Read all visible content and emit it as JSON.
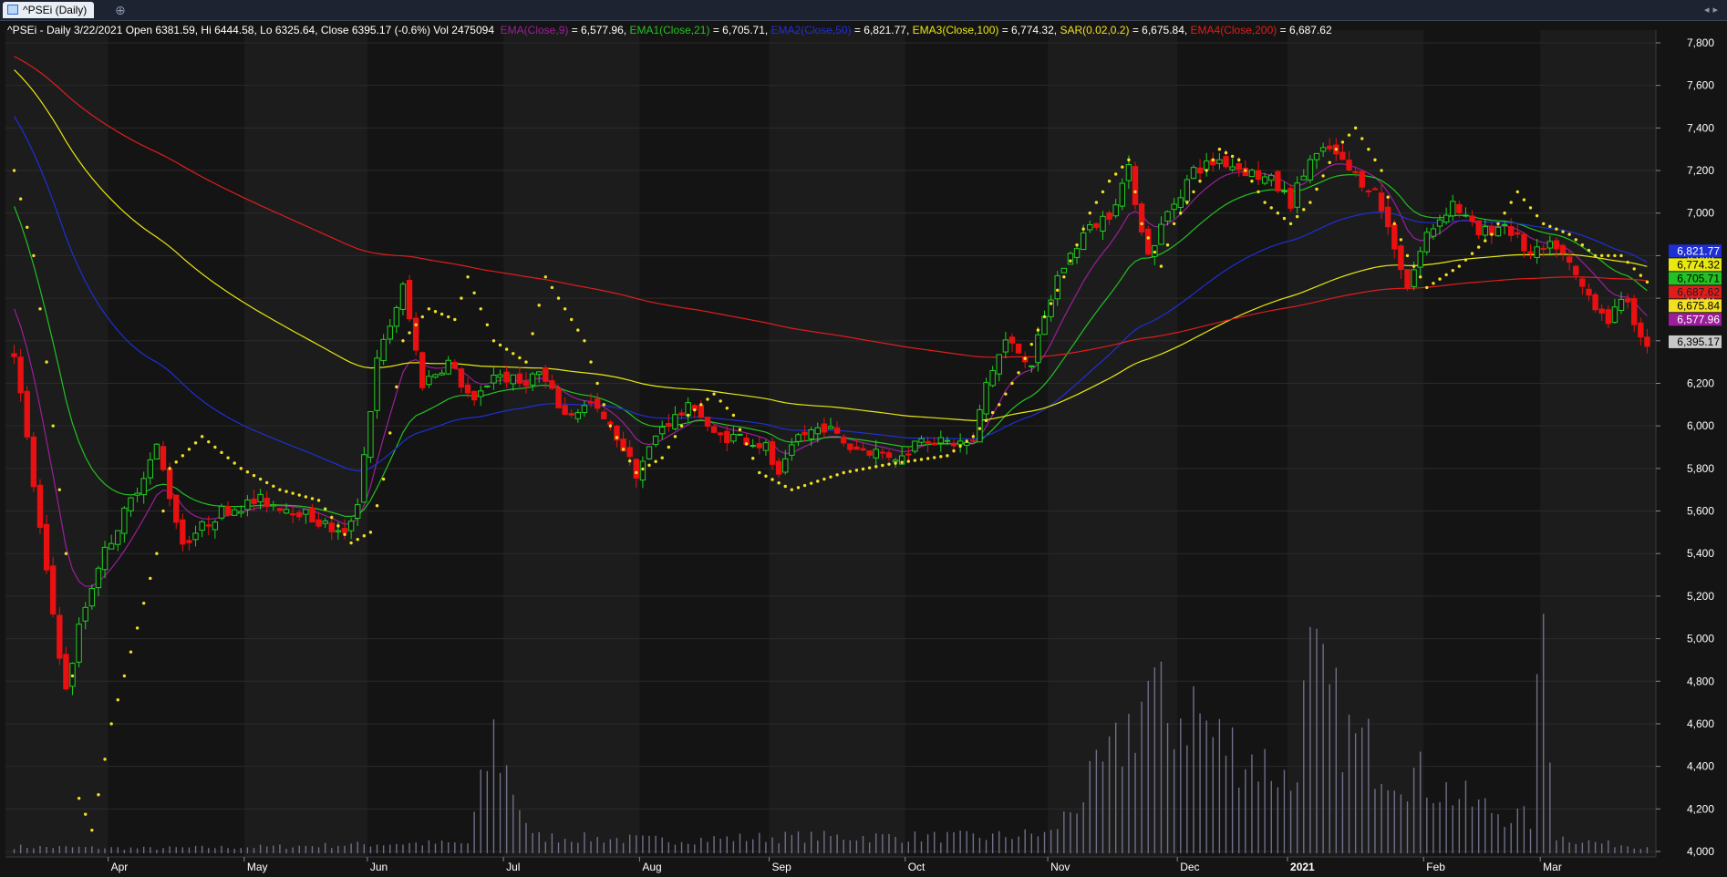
{
  "tab": {
    "title": "^PSEi (Daily)",
    "icon": "chart-icon"
  },
  "header": {
    "main": "^PSEi - Daily 3/22/2021 Open 6381.59, Hi 6444.58, Lo 6325.64, Close 6395.17 (-0.6%) Vol 2475094",
    "indicators": [
      {
        "name": "EMA(Close,9)",
        "value": "6,577.96",
        "color": "#9b1f9b"
      },
      {
        "name": "EMA1(Close,21)",
        "value": "6,705.71",
        "color": "#23c123"
      },
      {
        "name": "EMA2(Close,50)",
        "value": "6,821.77",
        "color": "#1f2fd6"
      },
      {
        "name": "EMA3(Close,100)",
        "value": "6,774.32",
        "color": "#e8e812"
      },
      {
        "name": "SAR(0.02,0.2)",
        "value": "6,675.84",
        "color": "#f2e022"
      },
      {
        "name": "EMA4(Close,200)",
        "value": "6,687.62",
        "color": "#e01d1d"
      }
    ]
  },
  "chart_data": {
    "type": "candlestick",
    "symbol": "^PSEi",
    "interval": "Daily",
    "ylim": [
      4000,
      7800
    ],
    "y_ticks": [
      4000,
      4200,
      4400,
      4600,
      4800,
      5000,
      5200,
      5400,
      5600,
      5800,
      6000,
      6200,
      6400,
      6600,
      6800,
      7000,
      7200,
      7400,
      7600,
      7800
    ],
    "y_tick_labels": [
      "4,000",
      "4,200",
      "4,400",
      "4,600",
      "4,800",
      "5,000",
      "5,200",
      "5,400",
      "5,600",
      "5,800",
      "6,000",
      "6,200",
      "6,400",
      "6,600",
      "6,800",
      "7,000",
      "7,200",
      "7,400",
      "7,600",
      "7,800"
    ],
    "x_labels": [
      {
        "label": "Apr",
        "bar": 15
      },
      {
        "label": "May",
        "bar": 36
      },
      {
        "label": "Jun",
        "bar": 55
      },
      {
        "label": "Jul",
        "bar": 76
      },
      {
        "label": "Aug",
        "bar": 97
      },
      {
        "label": "Sep",
        "bar": 117
      },
      {
        "label": "Oct",
        "bar": 138
      },
      {
        "label": "Nov",
        "bar": 160
      },
      {
        "label": "Dec",
        "bar": 180
      },
      {
        "label": "2021",
        "bar": 197
      },
      {
        "label": "Feb",
        "bar": 218
      },
      {
        "label": "Mar",
        "bar": 236
      }
    ],
    "close_keypoints": [
      [
        0,
        6350
      ],
      [
        5,
        5300
      ],
      [
        8,
        4750
      ],
      [
        10,
        5050
      ],
      [
        13,
        5350
      ],
      [
        18,
        5650
      ],
      [
        22,
        5900
      ],
      [
        26,
        5450
      ],
      [
        32,
        5600
      ],
      [
        38,
        5650
      ],
      [
        44,
        5600
      ],
      [
        51,
        5480
      ],
      [
        53,
        5650
      ],
      [
        56,
        6300
      ],
      [
        60,
        6650
      ],
      [
        63,
        6200
      ],
      [
        67,
        6300
      ],
      [
        71,
        6100
      ],
      [
        74,
        6250
      ],
      [
        78,
        6200
      ],
      [
        81,
        6250
      ],
      [
        85,
        6050
      ],
      [
        89,
        6100
      ],
      [
        93,
        5950
      ],
      [
        96,
        5780
      ],
      [
        100,
        6000
      ],
      [
        105,
        6100
      ],
      [
        108,
        5950
      ],
      [
        112,
        5950
      ],
      [
        116,
        5900
      ],
      [
        118,
        5750
      ],
      [
        121,
        5950
      ],
      [
        125,
        6000
      ],
      [
        129,
        5900
      ],
      [
        133,
        5880
      ],
      [
        137,
        5850
      ],
      [
        140,
        5960
      ],
      [
        143,
        5920
      ],
      [
        148,
        5920
      ],
      [
        150,
        6200
      ],
      [
        153,
        6400
      ],
      [
        157,
        6300
      ],
      [
        161,
        6700
      ],
      [
        165,
        6900
      ],
      [
        169,
        7000
      ],
      [
        172,
        7200
      ],
      [
        175,
        6800
      ],
      [
        178,
        7000
      ],
      [
        182,
        7200
      ],
      [
        186,
        7250
      ],
      [
        190,
        7200
      ],
      [
        194,
        7150
      ],
      [
        197,
        7050
      ],
      [
        200,
        7250
      ],
      [
        203,
        7300
      ],
      [
        206,
        7200
      ],
      [
        210,
        7100
      ],
      [
        213,
        6850
      ],
      [
        215,
        6650
      ],
      [
        218,
        6900
      ],
      [
        222,
        7050
      ],
      [
        226,
        6900
      ],
      [
        230,
        6950
      ],
      [
        234,
        6800
      ],
      [
        238,
        6850
      ],
      [
        242,
        6650
      ],
      [
        246,
        6500
      ],
      [
        249,
        6600
      ],
      [
        251,
        6400
      ],
      [
        252,
        6395.17
      ]
    ],
    "sar_keypoints": [
      [
        0,
        7200
      ],
      [
        3,
        6800
      ],
      [
        5,
        6300
      ],
      [
        8,
        5400
      ],
      [
        10,
        4250
      ],
      [
        12,
        4100
      ],
      [
        15,
        4600
      ],
      [
        19,
        5050
      ],
      [
        22,
        5400
      ],
      [
        24,
        5800
      ],
      [
        29,
        5950
      ],
      [
        35,
        5800
      ],
      [
        41,
        5700
      ],
      [
        47,
        5650
      ],
      [
        52,
        5450
      ],
      [
        55,
        5500
      ],
      [
        57,
        5750
      ],
      [
        60,
        6400
      ],
      [
        64,
        6550
      ],
      [
        68,
        6500
      ],
      [
        70,
        6700
      ],
      [
        74,
        6400
      ],
      [
        79,
        6300
      ],
      [
        82,
        6700
      ],
      [
        88,
        6400
      ],
      [
        92,
        6000
      ],
      [
        96,
        5780
      ],
      [
        100,
        5850
      ],
      [
        104,
        6050
      ],
      [
        108,
        6150
      ],
      [
        111,
        6050
      ],
      [
        115,
        5780
      ],
      [
        120,
        5700
      ],
      [
        128,
        5780
      ],
      [
        135,
        5820
      ],
      [
        144,
        5860
      ],
      [
        148,
        5950
      ],
      [
        152,
        6100
      ],
      [
        155,
        6250
      ],
      [
        158,
        6450
      ],
      [
        162,
        6700
      ],
      [
        166,
        7000
      ],
      [
        169,
        7150
      ],
      [
        172,
        7250
      ],
      [
        174,
        6950
      ],
      [
        177,
        6750
      ],
      [
        179,
        6950
      ],
      [
        183,
        7150
      ],
      [
        186,
        7300
      ],
      [
        189,
        7250
      ],
      [
        193,
        7050
      ],
      [
        197,
        6950
      ],
      [
        200,
        7050
      ],
      [
        204,
        7300
      ],
      [
        207,
        7400
      ],
      [
        211,
        7200
      ],
      [
        213,
        6950
      ],
      [
        215,
        6800
      ],
      [
        218,
        6650
      ],
      [
        223,
        6750
      ],
      [
        228,
        6900
      ],
      [
        232,
        7100
      ],
      [
        236,
        6950
      ],
      [
        240,
        6900
      ],
      [
        244,
        6800
      ],
      [
        248,
        6800
      ],
      [
        252,
        6676
      ]
    ],
    "volume_keypoints": [
      [
        0,
        0.02
      ],
      [
        20,
        0.015
      ],
      [
        40,
        0.02
      ],
      [
        60,
        0.03
      ],
      [
        70,
        0.03
      ],
      [
        74,
        0.35
      ],
      [
        80,
        0.05
      ],
      [
        100,
        0.04
      ],
      [
        120,
        0.05
      ],
      [
        140,
        0.05
      ],
      [
        150,
        0.05
      ],
      [
        160,
        0.06
      ],
      [
        170,
        0.3
      ],
      [
        175,
        0.5
      ],
      [
        178,
        0.4
      ],
      [
        182,
        0.45
      ],
      [
        185,
        0.35
      ],
      [
        190,
        0.3
      ],
      [
        195,
        0.25
      ],
      [
        197,
        0.2
      ],
      [
        200,
        0.55
      ],
      [
        203,
        0.45
      ],
      [
        206,
        0.35
      ],
      [
        210,
        0.3
      ],
      [
        215,
        0.25
      ],
      [
        220,
        0.2
      ],
      [
        225,
        0.15
      ],
      [
        230,
        0.12
      ],
      [
        234,
        0.1
      ],
      [
        236,
        0.72
      ],
      [
        238,
        0.05
      ],
      [
        245,
        0.03
      ],
      [
        252,
        0.02
      ]
    ],
    "bar_count": 253,
    "series": [
      {
        "name": "EMA(Close,9)",
        "period": 9,
        "color": "#9b1f9b",
        "last": 6577.96
      },
      {
        "name": "EMA1(Close,21)",
        "period": 21,
        "color": "#23c123",
        "last": 6705.71
      },
      {
        "name": "EMA2(Close,50)",
        "period": 50,
        "color": "#1f2fd6",
        "last": 6821.77
      },
      {
        "name": "EMA3(Close,100)",
        "period": 100,
        "color": "#e8e812",
        "last": 6774.32
      },
      {
        "name": "SAR(0.02,0.2)",
        "color": "#f2e022",
        "last": 6675.84
      },
      {
        "name": "EMA4(Close,200)",
        "period": 200,
        "color": "#e01d1d",
        "last": 6687.62
      }
    ],
    "price_tags": [
      {
        "value": 6821.77,
        "label": "6,821.77",
        "bg": "#1f2fd6",
        "fg": "#ffffff"
      },
      {
        "value": 6774.32,
        "label": "6,774.32",
        "bg": "#e8e812",
        "fg": "#000000"
      },
      {
        "value": 6705.71,
        "label": "6,705.71",
        "bg": "#23c123",
        "fg": "#000000"
      },
      {
        "value": 6687.62,
        "label": "6,687.62",
        "bg": "#e01d1d",
        "fg": "#1d1d1d"
      },
      {
        "value": 6675.84,
        "label": "6,675.84",
        "bg": "#f2e022",
        "fg": "#000000"
      },
      {
        "value": 6577.96,
        "label": "6,577.96",
        "bg": "#9b1f9b",
        "fg": "#ffffff"
      },
      {
        "value": 6395.17,
        "label": "6,395.17",
        "bg": "#c8c8c8",
        "fg": "#000000"
      }
    ],
    "colors": {
      "background": "#141414",
      "band": "#1c1c1c",
      "grid": "#2a2a2a",
      "up": "#1fd01f",
      "down": "#e81010",
      "volume": "#6f6f8a",
      "axis_text": "#ffffff"
    },
    "grid": true
  }
}
